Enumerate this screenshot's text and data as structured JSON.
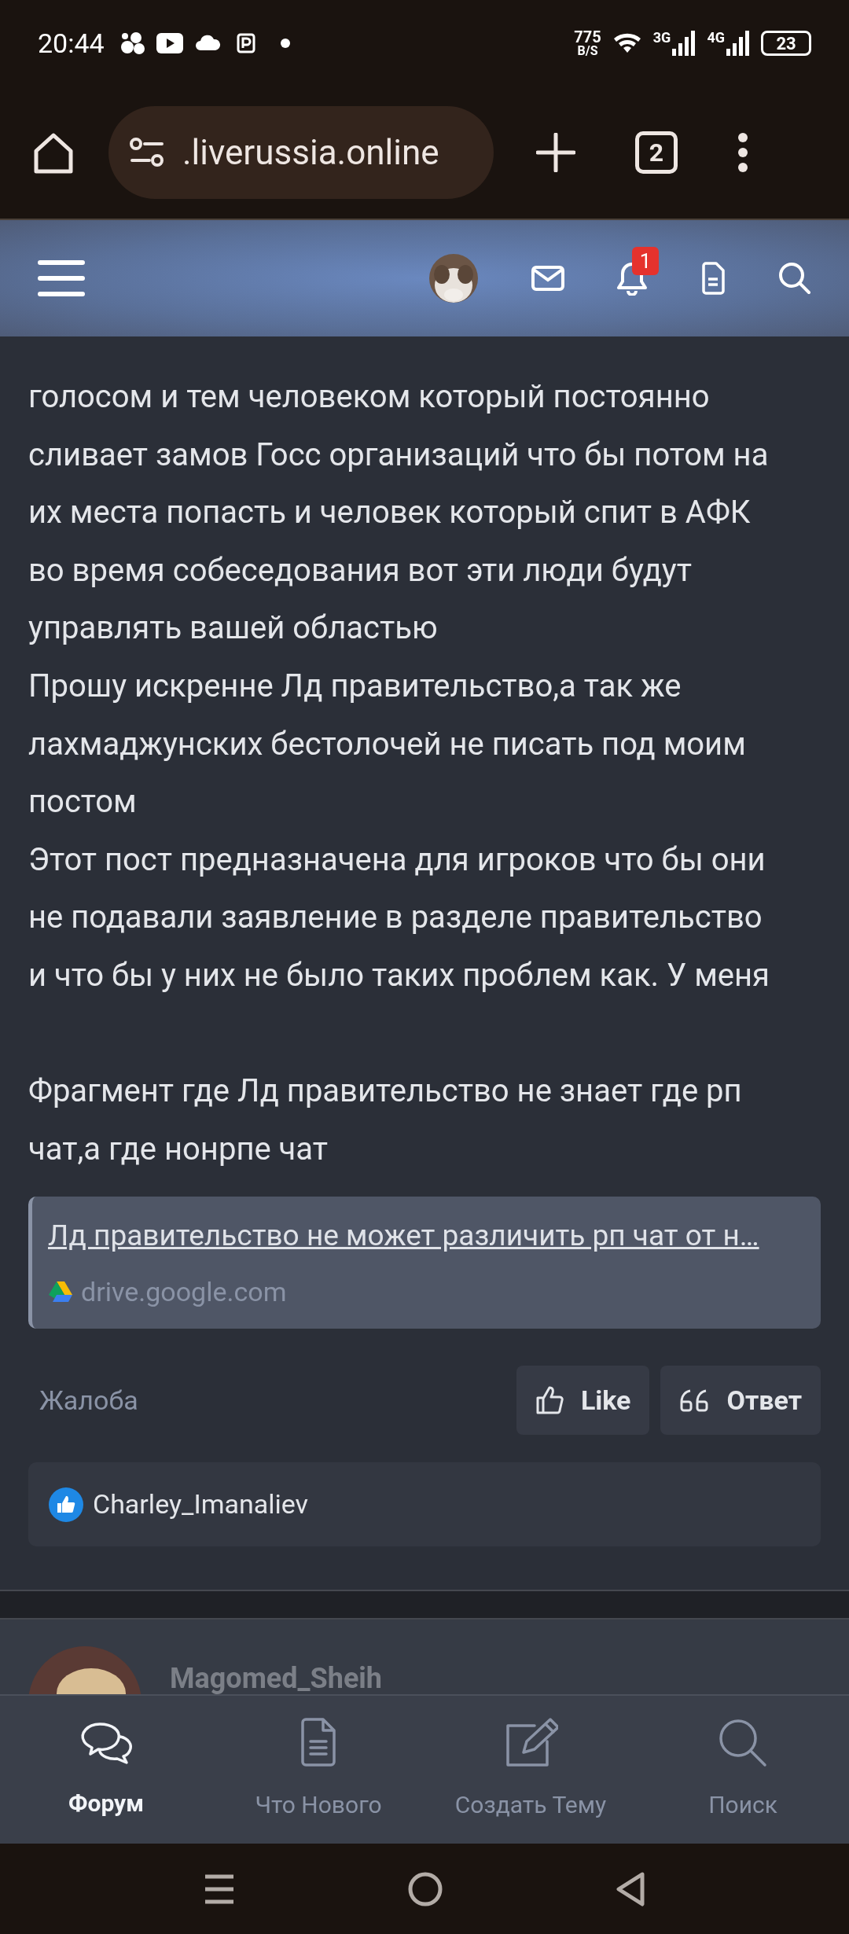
{
  "status_bar": {
    "time": "20:44",
    "net_speed": "775",
    "net_unit": "B/S",
    "signal_1_label": "3G",
    "signal_2_label": "4G",
    "battery": "23"
  },
  "browser": {
    "url": ".liverussia.online",
    "tab_count": "2"
  },
  "site_header": {
    "notification_count": "1"
  },
  "post": {
    "paragraphs": [
      {
        "lines": [
          "голосом и тем человеком который постоянно",
          "сливает замов Госс организаций что бы потом на",
          "их места попасть и человек который спит в АФК",
          "во время собеседования вот эти люди будут",
          "управлять вашей областью"
        ]
      },
      {
        "lines": [
          "Прошу искренне Лд правительство,а так же",
          "лахмаджунских бестолочей не писать под моим",
          "постом"
        ]
      },
      {
        "lines": [
          "Этот пост предназначена для игроков что бы они",
          "не подавали заявление в разделе правительство",
          "и что бы у них не было таких проблем как. У меня"
        ]
      },
      {
        "lines": [
          "Фрагмент где Лд правительство не знает где рп",
          "чат,а где нонрпе чат"
        ]
      }
    ],
    "link": {
      "title": "Лд правительство не может различить рп чат от н…",
      "domain": "drive.google.com"
    },
    "report": "Жалоба",
    "like": "Like",
    "reply": "Ответ",
    "reactions": {
      "users": "Charley_Imanaliev"
    }
  },
  "next_post": {
    "author": "Magomed_Sheih"
  },
  "bottom_nav": [
    {
      "label": "Форум",
      "kind": "forum",
      "selected": true
    },
    {
      "label": "Что Нового",
      "kind": "news",
      "selected": false
    },
    {
      "label": "Создать Тему",
      "kind": "create",
      "selected": false
    },
    {
      "label": "Поиск",
      "kind": "search",
      "selected": false
    }
  ]
}
